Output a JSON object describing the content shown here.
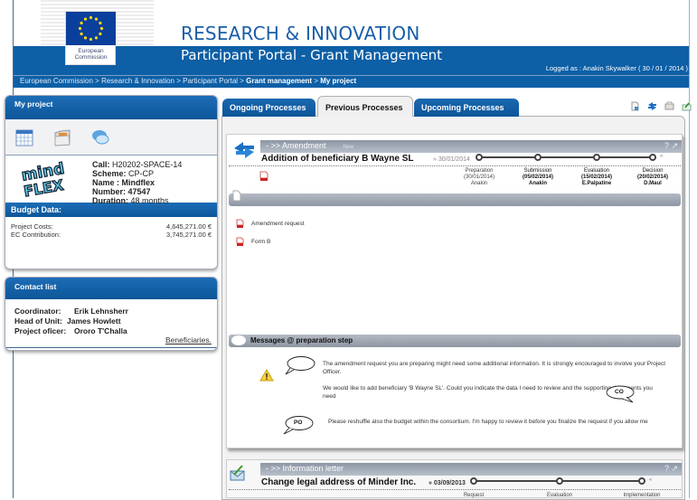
{
  "header": {
    "org_line1": "European",
    "org_line2": "Commission",
    "title": "RESEARCH & INNOVATION",
    "subtitle": "Participant Portal - Grant Management",
    "logged_as": "Logged as : Anakin Skywalker  ( 30 / 01 / 2014 )"
  },
  "breadcrumb": [
    {
      "label": "European Commission",
      "bold": false
    },
    {
      "label": "Research & Innovation",
      "bold": false
    },
    {
      "label": "Participant Portal",
      "bold": false
    },
    {
      "label": "Grant management",
      "bold": true
    },
    {
      "label": "My project",
      "bold": true
    }
  ],
  "breadcrumb_sep": " > ",
  "project_panel": {
    "title": "My project",
    "icons": [
      "calendar-icon",
      "folder-icon",
      "chat-icon"
    ],
    "logo_text_1": "mind",
    "logo_text_2": "FLEX",
    "fields": [
      {
        "label": "Call:",
        "value": " H20202-SPACE-14",
        "bold_value": false
      },
      {
        "label": "Scheme:",
        "value": " CP-CP",
        "bold_value": false
      },
      {
        "label": "Name :",
        "value": " Mindflex",
        "bold_value": true
      },
      {
        "label": "Number:",
        "value": " 47547",
        "bold_value": true
      },
      {
        "label": "Duration:",
        "value": " 48 months",
        "bold_value": false
      }
    ],
    "budget_title": "Budget Data:",
    "budget": [
      {
        "label": "Project Costs:",
        "value": "4,645,271.00 €"
      },
      {
        "label": "EC Contribution:",
        "value": "3,745,271.00 €"
      }
    ]
  },
  "contact_panel": {
    "title": "Contact list",
    "contacts": [
      {
        "role": "Coordinator:",
        "name": "Erik Lehnsherr"
      },
      {
        "role": "Head of Unit:",
        "name": "James Howlett"
      },
      {
        "role": "Project oficer:",
        "name": "Ororo T'Challa"
      }
    ],
    "beneficiaries_link": "Beneficiaries."
  },
  "tabs": [
    {
      "label": "Ongoing Processes",
      "active": false
    },
    {
      "label": "Previous Processes",
      "active": true
    },
    {
      "label": "Upcoming Processes",
      "active": false
    }
  ],
  "toolbar_icons": [
    "new-document-icon",
    "refresh-icon",
    "print-icon",
    "export-icon"
  ],
  "process": {
    "type": "- >> Amendment",
    "badge": "New",
    "help": "? ↗",
    "title": "Addition of beneficiary B Wayne SL",
    "date": "» 30/01/2014",
    "end_marker": "«",
    "steps": [
      {
        "name": "Preparation",
        "date": "(30/01/2014)",
        "person": "Anakin",
        "strong": false
      },
      {
        "name": "Submission",
        "date": "(05/02/2014)",
        "person": "Anakin",
        "strong": true
      },
      {
        "name": "Evaluation",
        "date": "(15/02/2014)",
        "person": "E.Palpatine",
        "strong": true
      },
      {
        "name": "Decision",
        "date": "(20/02/2014)",
        "person": "D.Maul",
        "strong": true
      }
    ],
    "documents": [
      "Amendment request",
      "Form B"
    ]
  },
  "messages": {
    "title": "Messages @ preparation step",
    "items": [
      {
        "from": "",
        "text": "The amendment request you are preparing might need some additional information. It is strongly encouraged to involve your Project Officer."
      },
      {
        "from": "CO",
        "text": "We would like to add beneficiary 'B Wayne SL'. Could you indicate the data I need to review and the supporting documents you need"
      },
      {
        "from": "PO",
        "text": "Please reshuffle also the budget within the consortium. I'm happy to review it before you finalize the request if you allow me"
      }
    ]
  },
  "process2": {
    "type": "- >> Information letter",
    "help": "? ↗",
    "title": "Change legal address of Minder Inc.",
    "date": "» 03/09/2013",
    "end_marker": "«",
    "steps": [
      "Request",
      "Evaluation",
      "Implementation"
    ]
  }
}
